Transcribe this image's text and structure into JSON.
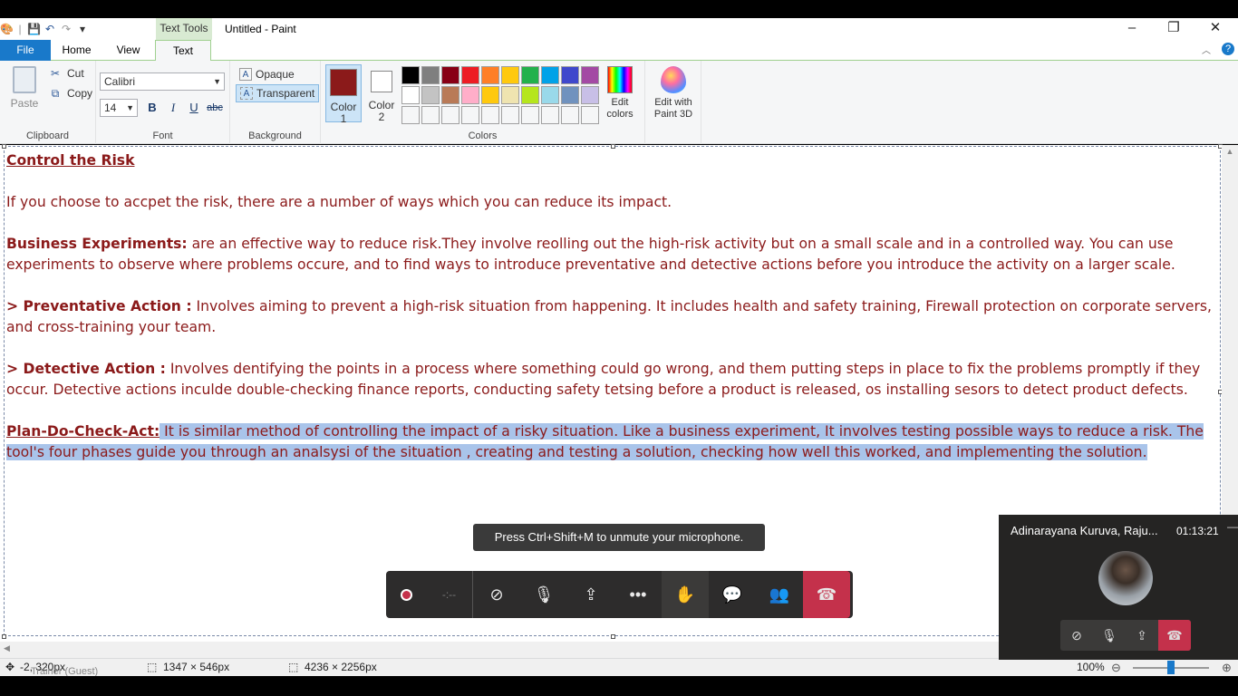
{
  "titlebar": {
    "context_tab": "Text Tools",
    "title": "Untitled - Paint"
  },
  "tabs": {
    "file": "File",
    "home": "Home",
    "view": "View",
    "text": "Text"
  },
  "ribbon": {
    "clipboard": {
      "paste": "Paste",
      "cut": "Cut",
      "copy": "Copy",
      "label": "Clipboard"
    },
    "font": {
      "family": "Calibri",
      "size": "14",
      "bold": "B",
      "italic": "I",
      "underline": "U",
      "strike": "abc",
      "label": "Font"
    },
    "background": {
      "opaque": "Opaque",
      "transparent": "Transparent",
      "label": "Background"
    },
    "colors": {
      "color1_label": "Color\n1",
      "color2_label": "Color\n2",
      "color1": "#8b1a1a",
      "color2": "#ffffff",
      "palette": [
        "#000000",
        "#7f7f7f",
        "#880015",
        "#ed1c24",
        "#ff7f27",
        "#ffc90e",
        "#22b14c",
        "#00a2e8",
        "#3f48cc",
        "#a349a4",
        "#ffffff",
        "#c3c3c3",
        "#b97a57",
        "#ffaec9",
        "#ffc90e",
        "#efe4b0",
        "#b5e61d",
        "#99d9ea",
        "#7092be",
        "#c8bfe7",
        "#f5f6f7",
        "#f5f6f7",
        "#f5f6f7",
        "#f5f6f7",
        "#f5f6f7",
        "#f5f6f7",
        "#f5f6f7",
        "#f5f6f7",
        "#f5f6f7",
        "#f5f6f7"
      ],
      "edit_colors": "Edit colors",
      "label": "Colors"
    },
    "paint3d": "Edit with Paint 3D"
  },
  "document": {
    "heading": "Control the Risk",
    "intro": "If you choose to accpet the risk, there are a number of ways which you can reduce its impact.",
    "p1_bold": "Business Experiments:",
    "p1_text": "  are an effective way to reduce risk.They involve reolling out the high-risk activity but on a small scale and in a controlled way. You can use experiments to observe where problems occure, and to find ways to introduce preventative and detective actions before you introduce the activity on a larger scale.",
    "p2_bold": "> Preventative Action :",
    "p2_text": " Involves aiming to prevent a high-risk situation from happening. It includes health and safety training, Firewall protection on corporate servers, and cross-training your team.",
    "p3_bold": "> Detective Action :",
    "p3_text": " Involves dentifying the points in a process where something  could go wrong, and them putting steps in place to fix the problems promptly if they occur. Detective actions inculde double-checking finance reports, conducting safety tetsing before a product is released, os installing sesors to detect product defects.",
    "p4_head": "Plan-Do-Check-Act:",
    "p4_text": " It is similar method of controlling the impact of a risky situation. Like a business experiment, It involves testing possible ways to reduce a risk. The tool's four phases guide you through an analsysi of the situation , creating and testing a solution, checking how well this worked, and implementing the solution."
  },
  "status": {
    "cursor": "-2, 320px",
    "selection": "1347 × 546px",
    "canvas": "4236 × 2256px",
    "zoom": "100%",
    "overlay_name": "Trainer (Guest)"
  },
  "teams": {
    "toast": "Press Ctrl+Shift+M to unmute your microphone.",
    "timer": "-:--",
    "mini_name": "Adinarayana Kuruva, Raju...",
    "mini_time": "01:13:21"
  }
}
